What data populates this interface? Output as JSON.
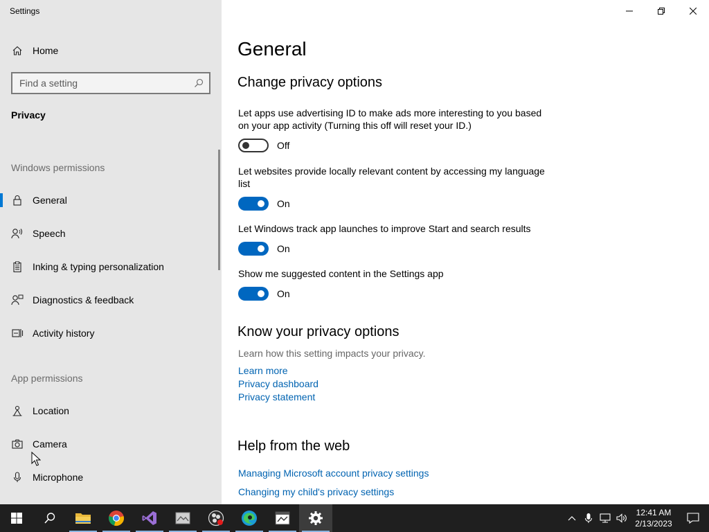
{
  "window": {
    "title": "Settings"
  },
  "sidebar": {
    "home_label": "Home",
    "search_placeholder": "Find a setting",
    "privacy_label": "Privacy",
    "windows_permissions_label": "Windows permissions",
    "windows_items": [
      {
        "label": "General",
        "icon": "lock-icon",
        "active": true
      },
      {
        "label": "Speech",
        "icon": "speech-icon"
      },
      {
        "label": "Inking & typing personalization",
        "icon": "clipboard-icon"
      },
      {
        "label": "Diagnostics & feedback",
        "icon": "feedback-icon"
      },
      {
        "label": "Activity history",
        "icon": "activity-icon"
      }
    ],
    "app_permissions_label": "App permissions",
    "app_items": [
      {
        "label": "Location",
        "icon": "location-icon"
      },
      {
        "label": "Camera",
        "icon": "camera-icon"
      },
      {
        "label": "Microphone",
        "icon": "microphone-icon"
      }
    ]
  },
  "main": {
    "title": "General",
    "change_heading": "Change privacy options",
    "settings": [
      {
        "desc": "Let apps use advertising ID to make ads more interesting to you based on your app activity (Turning this off will reset your ID.)",
        "state": "Off"
      },
      {
        "desc": "Let websites provide locally relevant content by accessing my language list",
        "state": "On"
      },
      {
        "desc": "Let Windows track app launches to improve Start and search results",
        "state": "On"
      },
      {
        "desc": "Show me suggested content in the Settings app",
        "state": "On"
      }
    ],
    "know_heading": "Know your privacy options",
    "know_desc": "Learn how this setting impacts your privacy.",
    "know_links": [
      "Learn more",
      "Privacy dashboard",
      "Privacy statement"
    ],
    "help_heading": "Help from the web",
    "help_links": [
      "Managing Microsoft account privacy settings",
      "Changing my child's privacy settings"
    ]
  },
  "taskbar": {
    "apps": [
      "start-icon",
      "search-icon",
      "file-explorer-icon",
      "chrome-icon",
      "visual-studio-icon",
      "app-icon",
      "obs-icon",
      "edge-icon",
      "photos-icon",
      "settings-icon"
    ],
    "time": "12:41 AM",
    "date": "2/13/2023"
  },
  "colors": {
    "accent": "#0067c0",
    "link": "#0063b1",
    "sidebar_bg": "#e6e6e6",
    "taskbar_bg": "#1f1f1f"
  }
}
